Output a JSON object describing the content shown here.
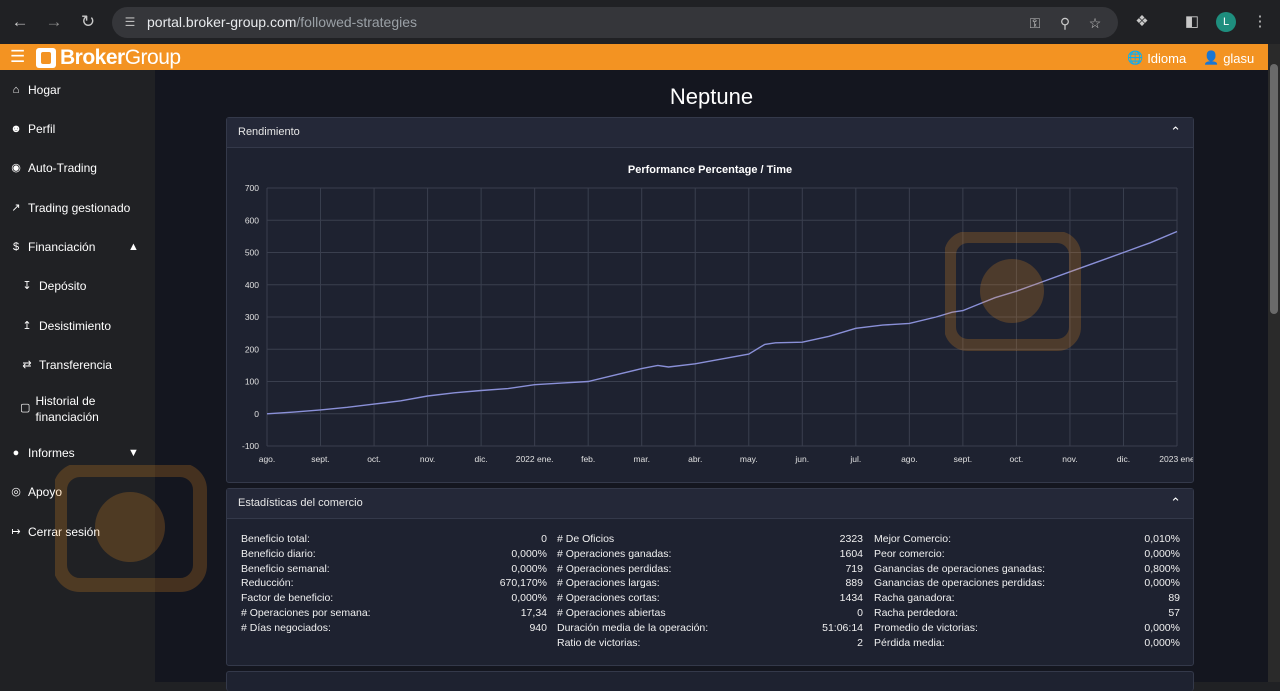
{
  "browser": {
    "url_host": "portal.broker-group.com",
    "url_path": "/followed-strategies",
    "profile_initial": "L"
  },
  "topbar": {
    "brand_bold": "Broker",
    "brand_light": "Group",
    "language_label": "Idioma",
    "user_label": "glasu",
    "accent_color": "#f39322"
  },
  "sidebar": {
    "items": [
      {
        "label": "Hogar",
        "icon": "home-icon"
      },
      {
        "label": "Perfil",
        "icon": "user-icon"
      },
      {
        "label": "Auto-Trading",
        "icon": "robot-icon"
      },
      {
        "label": "Trading gestionado",
        "icon": "trend-icon"
      },
      {
        "label": "Financiación",
        "icon": "finance-icon"
      },
      {
        "label": "Depósito",
        "icon": "deposit-icon"
      },
      {
        "label": "Desistimiento",
        "icon": "withdraw-icon"
      },
      {
        "label": "Transferencia",
        "icon": "transfer-icon"
      },
      {
        "label": "Historial de financiación",
        "icon": "file-icon"
      },
      {
        "label": "Informes",
        "icon": "reports-icon"
      },
      {
        "label": "Apoyo",
        "icon": "support-icon"
      },
      {
        "label": "Cerrar sesión",
        "icon": "logout-icon"
      }
    ]
  },
  "page": {
    "title": "Neptune"
  },
  "performance": {
    "header": "Rendimiento"
  },
  "chart_data": {
    "type": "line",
    "title": "Performance Percentage / Time",
    "xlabel": "",
    "ylabel": "",
    "ylim": [
      -100,
      700
    ],
    "yticks": [
      -100,
      0,
      100,
      200,
      300,
      400,
      500,
      600,
      700
    ],
    "xticks": [
      "ago.",
      "sept.",
      "oct.",
      "nov.",
      "dic.",
      "2022 ene.",
      "feb.",
      "mar.",
      "abr.",
      "may.",
      "jun.",
      "jul.",
      "ago.",
      "sept.",
      "oct.",
      "nov.",
      "dic.",
      "2023 ene"
    ],
    "grid": true,
    "series": [
      {
        "x": [
          0,
          0.5,
          1,
          1.5,
          2,
          2.5,
          3,
          3.5,
          4,
          4.5,
          5,
          5.5,
          6,
          6.5,
          7,
          7.3,
          7.5,
          8,
          8.5,
          9,
          9.3,
          9.5,
          10,
          10.5,
          11,
          11.5,
          12,
          12.5,
          12.8,
          13,
          13.3,
          13.6,
          14,
          14.5,
          15,
          15.5,
          16,
          16.5,
          17
        ],
        "values": [
          0,
          5,
          12,
          20,
          30,
          40,
          55,
          65,
          72,
          78,
          90,
          95,
          100,
          120,
          140,
          150,
          145,
          155,
          170,
          185,
          215,
          220,
          222,
          240,
          265,
          275,
          280,
          300,
          315,
          320,
          340,
          360,
          380,
          410,
          440,
          470,
          500,
          530,
          565
        ]
      }
    ]
  },
  "stats": {
    "header": "Estadísticas del comercio",
    "col1": [
      {
        "label": "Beneficio total:",
        "value": "0"
      },
      {
        "label": "Beneficio diario:",
        "value": "0,000%"
      },
      {
        "label": "Beneficio semanal:",
        "value": "0,000%"
      },
      {
        "label": "Reducción:",
        "value": "670,170%"
      },
      {
        "label": "Factor de beneficio:",
        "value": "0,000%"
      },
      {
        "label": "# Operaciones por semana:",
        "value": "17,34"
      },
      {
        "label": "# Días negociados:",
        "value": "940"
      }
    ],
    "col2": [
      {
        "label": "# De Oficios",
        "value": "2323"
      },
      {
        "label": "# Operaciones ganadas:",
        "value": "1604"
      },
      {
        "label": "# Operaciones perdidas:",
        "value": "719"
      },
      {
        "label": "# Operaciones largas:",
        "value": "889"
      },
      {
        "label": "# Operaciones cortas:",
        "value": "1434"
      },
      {
        "label": "# Operaciones abiertas",
        "value": "0"
      },
      {
        "label": "Duración media de la operación:",
        "value": "51:06:14"
      },
      {
        "label": "Ratio de victorias:",
        "value": "2"
      }
    ],
    "col3": [
      {
        "label": "Mejor Comercio:",
        "value": "0,010%"
      },
      {
        "label": "Peor comercio:",
        "value": "0,000%"
      },
      {
        "label": "Ganancias de operaciones ganadas:",
        "value": "0,800%"
      },
      {
        "label": "Ganancias de operaciones perdidas:",
        "value": "0,000%"
      },
      {
        "label": "Racha ganadora:",
        "value": "89"
      },
      {
        "label": "Racha perdedora:",
        "value": "57"
      },
      {
        "label": "Promedio de victorias:",
        "value": "0,000%"
      },
      {
        "label": "Pérdida media:",
        "value": "0,000%"
      }
    ]
  }
}
